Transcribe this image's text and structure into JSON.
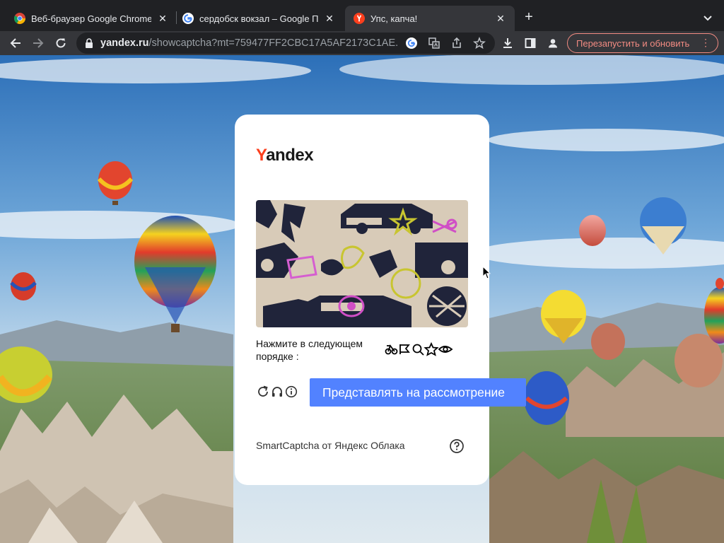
{
  "browser": {
    "tabs": [
      {
        "title": "Веб-браузер Google Chrome",
        "favicon": "chrome-icon",
        "active": false
      },
      {
        "title": "сердобск вокзал – Google Поиск",
        "favicon": "google-icon",
        "active": false
      },
      {
        "title": "Упс, капча!",
        "favicon": "yandex-icon",
        "active": true
      }
    ],
    "address": {
      "host": "yandex.ru",
      "path": "/showcaptcha?mt=759477FF2CBC17A5AF2173C1AE..."
    },
    "relaunch_label": "Перезапустить и обновить",
    "accent_color": "#f28b82"
  },
  "captcha": {
    "logo_prefix": "Y",
    "logo_rest": "andex",
    "logo_color": "#fc3f1d",
    "instruction": "Нажмите в следующем порядке :",
    "sequence_icons": [
      "bicycle-icon",
      "flag-icon",
      "magnifier-icon",
      "star-icon",
      "eye-icon"
    ],
    "submit_label": "Представлять на рассмотрение",
    "submit_color": "#5282ff",
    "footer": "SmartCaptcha от Яндекс Облака",
    "controls": [
      "refresh-icon",
      "audio-icon",
      "info-icon",
      "help-icon"
    ]
  }
}
